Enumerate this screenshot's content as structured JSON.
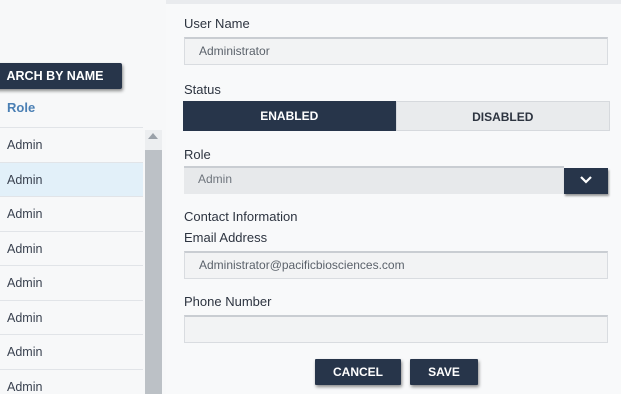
{
  "left_panel": {
    "search_button": "ARCH BY NAME",
    "role_header": "Role",
    "rows": [
      "Admin",
      "Admin",
      "Admin",
      "Admin",
      "Admin",
      "Admin",
      "Admin",
      "Admin"
    ]
  },
  "form": {
    "user_name_label": "User Name",
    "user_name_value": "Administrator",
    "status_label": "Status",
    "status_enabled": "ENABLED",
    "status_disabled": "DISABLED",
    "status_selected": "ENABLED",
    "role_label": "Role",
    "role_value": "Admin",
    "contact_header": "Contact Information",
    "email_label": "Email Address",
    "email_value": "Administrator@pacificbiosciences.com",
    "phone_label": "Phone Number",
    "phone_value": "",
    "cancel_button": "CANCEL",
    "save_button": "SAVE"
  },
  "icons": {
    "dropdown": "chevron-down-icon",
    "scroll_up": "scroll-up-arrow-icon"
  },
  "colors": {
    "primary_dark": "#27354a",
    "selected_row": "#e2f0f9",
    "link_blue": "#4a7fb4"
  }
}
